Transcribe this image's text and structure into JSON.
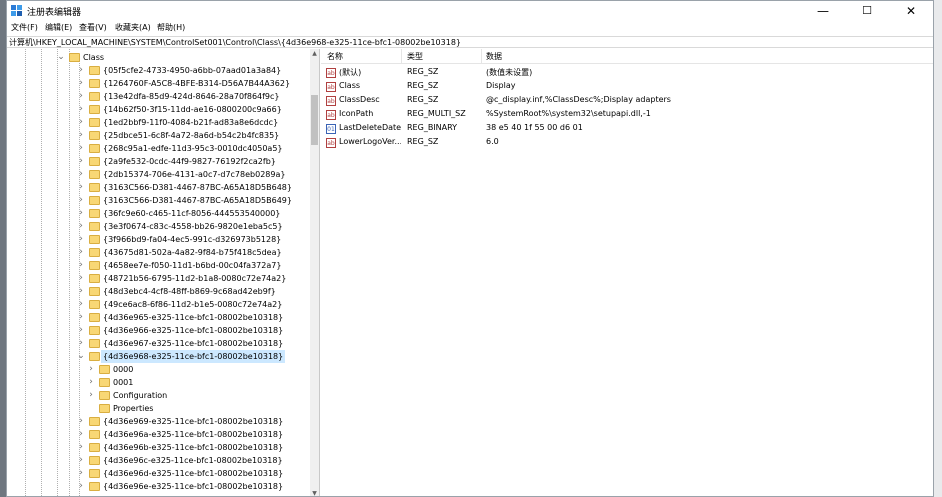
{
  "window": {
    "title": "注册表编辑器",
    "minimize": "—",
    "maximize": "☐",
    "close": "✕"
  },
  "menu": [
    "文件(F)",
    "编辑(E)",
    "查看(V)",
    "收藏夹(A)",
    "帮助(H)"
  ],
  "address": "计算机\\HKEY_LOCAL_MACHINE\\SYSTEM\\ControlSet001\\Control\\Class\\{4d36e968-e325-11ce-bfc1-08002be10318}",
  "tree": {
    "root": "Class",
    "items": [
      {
        "label": "{05f5cfe2-4733-4950-a6bb-07aad01a3a84}"
      },
      {
        "label": "{1264760F-A5C8-4BFE-B314-D56A7B44A362}"
      },
      {
        "label": "{13e42dfa-85d9-424d-8646-28a70f864f9c}"
      },
      {
        "label": "{14b62f50-3f15-11dd-ae16-0800200c9a66}"
      },
      {
        "label": "{1ed2bbf9-11f0-4084-b21f-ad83a8e6dcdc}"
      },
      {
        "label": "{25dbce51-6c8f-4a72-8a6d-b54c2b4fc835}"
      },
      {
        "label": "{268c95a1-edfe-11d3-95c3-0010dc4050a5}"
      },
      {
        "label": "{2a9fe532-0cdc-44f9-9827-76192f2ca2fb}"
      },
      {
        "label": "{2db15374-706e-4131-a0c7-d7c78eb0289a}"
      },
      {
        "label": "{3163C566-D381-4467-87BC-A65A18D5B648}"
      },
      {
        "label": "{3163C566-D381-4467-87BC-A65A18D5B649}"
      },
      {
        "label": "{36fc9e60-c465-11cf-8056-444553540000}"
      },
      {
        "label": "{3e3f0674-c83c-4558-bb26-9820e1eba5c5}"
      },
      {
        "label": "{3f966bd9-fa04-4ec5-991c-d326973b5128}"
      },
      {
        "label": "{43675d81-502a-4a82-9f84-b75f418c5dea}"
      },
      {
        "label": "{4658ee7e-f050-11d1-b6bd-00c04fa372a7}"
      },
      {
        "label": "{48721b56-6795-11d2-b1a8-0080c72e74a2}"
      },
      {
        "label": "{48d3ebc4-4cf8-48ff-b869-9c68ad42eb9f}"
      },
      {
        "label": "{49ce6ac8-6f86-11d2-b1e5-0080c72e74a2}"
      },
      {
        "label": "{4d36e965-e325-11ce-bfc1-08002be10318}"
      },
      {
        "label": "{4d36e966-e325-11ce-bfc1-08002be10318}"
      },
      {
        "label": "{4d36e967-e325-11ce-bfc1-08002be10318}"
      },
      {
        "label": "{4d36e968-e325-11ce-bfc1-08002be10318}"
      }
    ],
    "children": [
      {
        "label": "0000"
      },
      {
        "label": "0001"
      },
      {
        "label": "Configuration"
      },
      {
        "label": "Properties"
      }
    ],
    "after": [
      {
        "label": "{4d36e969-e325-11ce-bfc1-08002be10318}"
      },
      {
        "label": "{4d36e96a-e325-11ce-bfc1-08002be10318}"
      },
      {
        "label": "{4d36e96b-e325-11ce-bfc1-08002be10318}"
      },
      {
        "label": "{4d36e96c-e325-11ce-bfc1-08002be10318}"
      },
      {
        "label": "{4d36e96d-e325-11ce-bfc1-08002be10318}"
      },
      {
        "label": "{4d36e96e-e325-11ce-bfc1-08002be10318}"
      }
    ]
  },
  "list": {
    "headers": [
      "名称",
      "类型",
      "数据"
    ],
    "rows": [
      {
        "name": "(默认)",
        "type": "REG_SZ",
        "data": "(数值未设置)",
        "icon": "string-value-icon"
      },
      {
        "name": "Class",
        "type": "REG_SZ",
        "data": "Display",
        "icon": "string-value-icon"
      },
      {
        "name": "ClassDesc",
        "type": "REG_SZ",
        "data": "@c_display.inf,%ClassDesc%;Display adapters",
        "icon": "string-value-icon"
      },
      {
        "name": "IconPath",
        "type": "REG_MULTI_SZ",
        "data": "%SystemRoot%\\system32\\setupapi.dll,-1",
        "icon": "string-value-icon"
      },
      {
        "name": "LastDeleteDate",
        "type": "REG_BINARY",
        "data": "38 e5 40 1f 55 00 d6 01",
        "icon": "binary-value-icon"
      },
      {
        "name": "LowerLogoVer...",
        "type": "REG_SZ",
        "data": "6.0",
        "icon": "string-value-icon"
      }
    ]
  }
}
